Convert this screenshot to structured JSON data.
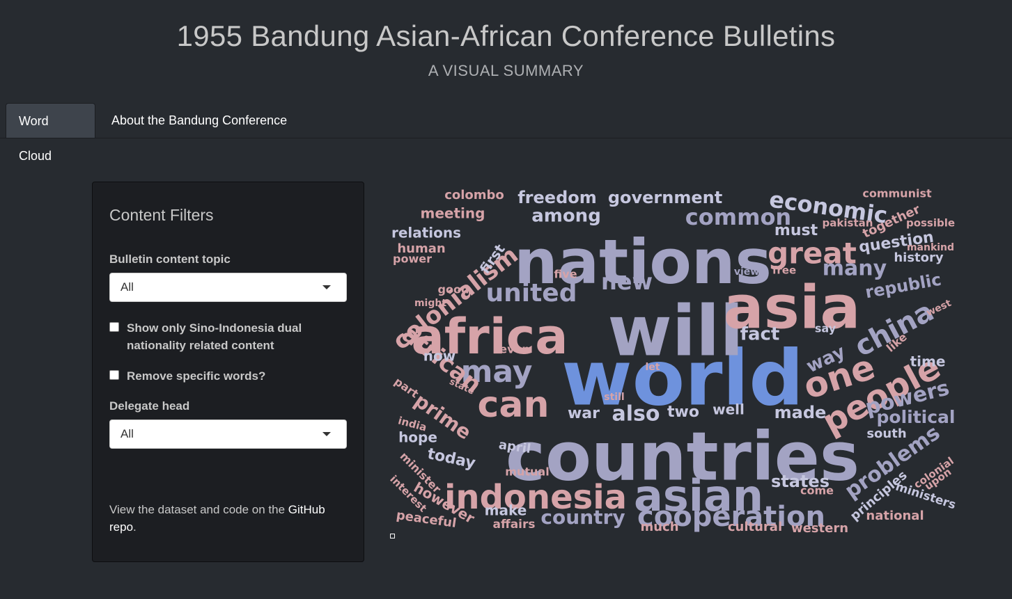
{
  "header": {
    "title": "1955 Bandung Asian-African Conference Bulletins",
    "subtitle": "A VISUAL SUMMARY"
  },
  "tabs": [
    {
      "label": "Word Cloud",
      "active": true
    },
    {
      "label": "About the Bandung Conference",
      "active": false
    }
  ],
  "sidebar": {
    "title": "Content Filters",
    "topic_label": "Bulletin content topic",
    "topic_value": "All",
    "checkbox_dual": "Show only Sino-Indonesia dual nationality related content",
    "checkbox_remove": "Remove specific words?",
    "delegate_label": "Delegate head",
    "delegate_value": "All",
    "footer_prefix": "View the dataset and code on the ",
    "footer_link": "GitHub repo",
    "footer_suffix": "."
  },
  "colors": {
    "background": "#272b30",
    "panel": "#1c1e22",
    "blue": "#6e92dd",
    "lavender": "#a3a3c3",
    "light_lavender": "#c6c7df",
    "pink": "#d6a3a8",
    "rose": "#cfa0a4"
  },
  "wordcloud": {
    "words": [
      {
        "text": "world",
        "weight": 100
      },
      {
        "text": "countries",
        "weight": 96
      },
      {
        "text": "will",
        "weight": 92
      },
      {
        "text": "nations",
        "weight": 86
      },
      {
        "text": "asia",
        "weight": 80
      },
      {
        "text": "africa",
        "weight": 72
      },
      {
        "text": "asian",
        "weight": 66
      },
      {
        "text": "indonesia",
        "weight": 56
      },
      {
        "text": "people",
        "weight": 54
      },
      {
        "text": "one",
        "weight": 52
      },
      {
        "text": "can",
        "weight": 50
      },
      {
        "text": "may",
        "weight": 46
      },
      {
        "text": "great",
        "weight": 44
      },
      {
        "text": "cooperation",
        "weight": 44
      },
      {
        "text": "united",
        "weight": 40
      },
      {
        "text": "china",
        "weight": 40
      },
      {
        "text": "economic",
        "weight": 38
      },
      {
        "text": "common",
        "weight": 38
      },
      {
        "text": "colonialism",
        "weight": 36
      },
      {
        "text": "african",
        "weight": 36
      },
      {
        "text": "new",
        "weight": 34
      },
      {
        "text": "many",
        "weight": 32
      },
      {
        "text": "powers",
        "weight": 32
      },
      {
        "text": "country",
        "weight": 30
      },
      {
        "text": "problems",
        "weight": 30
      },
      {
        "text": "also",
        "weight": 30
      },
      {
        "text": "prime",
        "weight": 28
      },
      {
        "text": "freedom",
        "weight": 26
      },
      {
        "text": "government",
        "weight": 26
      },
      {
        "text": "among",
        "weight": 26
      },
      {
        "text": "republic",
        "weight": 26
      },
      {
        "text": "must",
        "weight": 24
      },
      {
        "text": "fact",
        "weight": 24
      },
      {
        "text": "way",
        "weight": 24
      },
      {
        "text": "political",
        "weight": 24
      },
      {
        "text": "states",
        "weight": 24
      },
      {
        "text": "made",
        "weight": 24
      },
      {
        "text": "question",
        "weight": 22
      },
      {
        "text": "today",
        "weight": 22
      },
      {
        "text": "war",
        "weight": 22
      },
      {
        "text": "two",
        "weight": 22
      },
      {
        "text": "well",
        "weight": 22
      },
      {
        "text": "meeting",
        "weight": 20
      },
      {
        "text": "relations",
        "weight": 20
      },
      {
        "text": "colombo",
        "weight": 18
      },
      {
        "text": "first",
        "weight": 18
      },
      {
        "text": "history",
        "weight": 18
      },
      {
        "text": "time",
        "weight": 18
      },
      {
        "text": "now",
        "weight": 18
      },
      {
        "text": "make",
        "weight": 18
      },
      {
        "text": "together",
        "weight": 18
      },
      {
        "text": "principles",
        "weight": 18
      },
      {
        "text": "hope",
        "weight": 18
      },
      {
        "text": "however",
        "weight": 18
      },
      {
        "text": "western",
        "weight": 18
      },
      {
        "text": "cultural",
        "weight": 18
      },
      {
        "text": "much",
        "weight": 18
      },
      {
        "text": "south",
        "weight": 18
      },
      {
        "text": "ministers",
        "weight": 18
      },
      {
        "text": "national",
        "weight": 18
      },
      {
        "text": "human",
        "weight": 16
      },
      {
        "text": "power",
        "weight": 16
      },
      {
        "text": "communist",
        "weight": 16
      },
      {
        "text": "pakistan",
        "weight": 15
      },
      {
        "text": "possible",
        "weight": 15
      },
      {
        "text": "mankind",
        "weight": 14
      },
      {
        "text": "five",
        "weight": 16
      },
      {
        "text": "view",
        "weight": 14
      },
      {
        "text": "free",
        "weight": 15
      },
      {
        "text": "good",
        "weight": 16
      },
      {
        "text": "might",
        "weight": 14
      },
      {
        "text": "even",
        "weight": 16
      },
      {
        "text": "say",
        "weight": 16
      },
      {
        "text": "like",
        "weight": 16
      },
      {
        "text": "west",
        "weight": 14
      },
      {
        "text": "let",
        "weight": 14
      },
      {
        "text": "state",
        "weight": 13
      },
      {
        "text": "still",
        "weight": 14
      },
      {
        "text": "part",
        "weight": 16
      },
      {
        "text": "india",
        "weight": 15
      },
      {
        "text": "april",
        "weight": 18
      },
      {
        "text": "mutual",
        "weight": 16
      },
      {
        "text": "minister",
        "weight": 16
      },
      {
        "text": "interest",
        "weight": 15
      },
      {
        "text": "peaceful",
        "weight": 18
      },
      {
        "text": "affairs",
        "weight": 17
      },
      {
        "text": "come",
        "weight": 16
      },
      {
        "text": "colonial",
        "weight": 15
      },
      {
        "text": "upon",
        "weight": 15
      }
    ]
  }
}
